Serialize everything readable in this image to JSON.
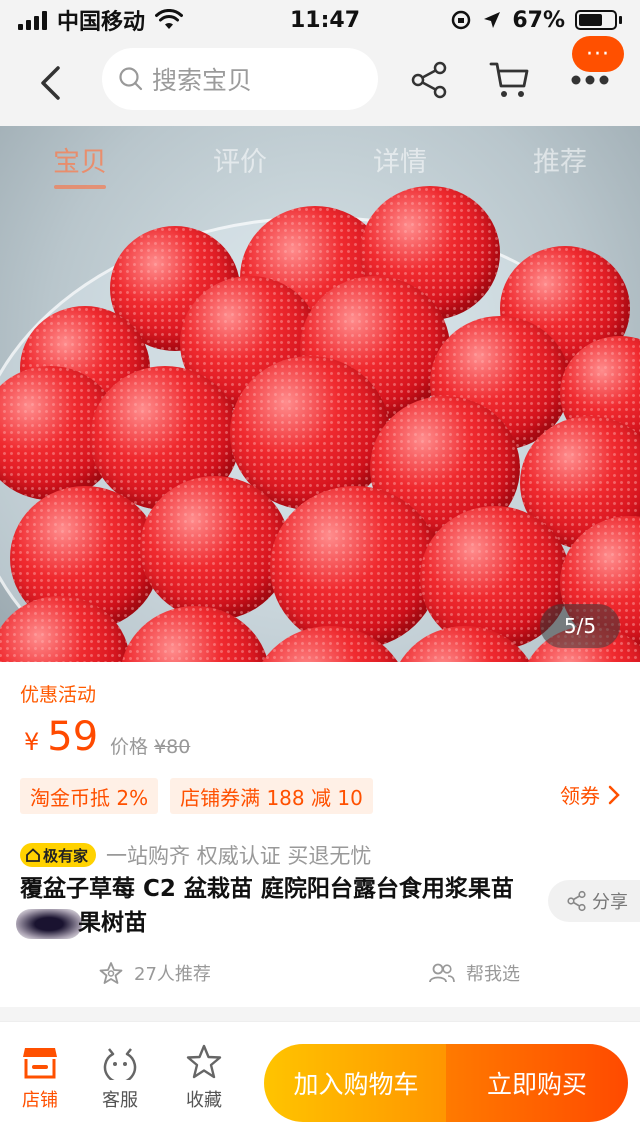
{
  "status_bar": {
    "carrier": "中国移动",
    "time": "11:47",
    "battery": "67%",
    "battery_level": 0.67
  },
  "top_nav": {
    "search_placeholder": "搜索宝贝",
    "more_badge": "···",
    "icons": [
      "back-arrow-icon",
      "search-icon",
      "share-icon",
      "cart-icon",
      "more-icon"
    ]
  },
  "tabs": [
    {
      "label": "宝贝",
      "active": true
    },
    {
      "label": "评价",
      "active": false
    },
    {
      "label": "详情",
      "active": false
    },
    {
      "label": "推荐",
      "active": false
    }
  ],
  "gallery": {
    "pager": "5/5"
  },
  "promo": {
    "title": "优惠活动",
    "currency": "¥",
    "price": "59",
    "original_label": "价格",
    "original_price": "¥80",
    "coupons": [
      "淘金币抵 2%",
      "店铺券满 188 减 10"
    ],
    "get_coupon": "领券"
  },
  "product": {
    "badge": "极有家",
    "tagline": "一站购齐 权威认证 买退无忧",
    "title_part1": "覆盆子草莓 C2 盆栽苗 庭院阳台露台食用浆果苗",
    "title_part2": "果树苗",
    "share": "分享",
    "recommend": "27人推荐",
    "help_choose": "帮我选"
  },
  "bottom_bar": {
    "shop": "店铺",
    "service": "客服",
    "favorite": "收藏",
    "add_to_cart": "加入购物车",
    "buy_now": "立即购买"
  },
  "colors": {
    "accent": "#ff5000",
    "cart_button": "#ffa800",
    "buy_button": "#ff5a00"
  }
}
